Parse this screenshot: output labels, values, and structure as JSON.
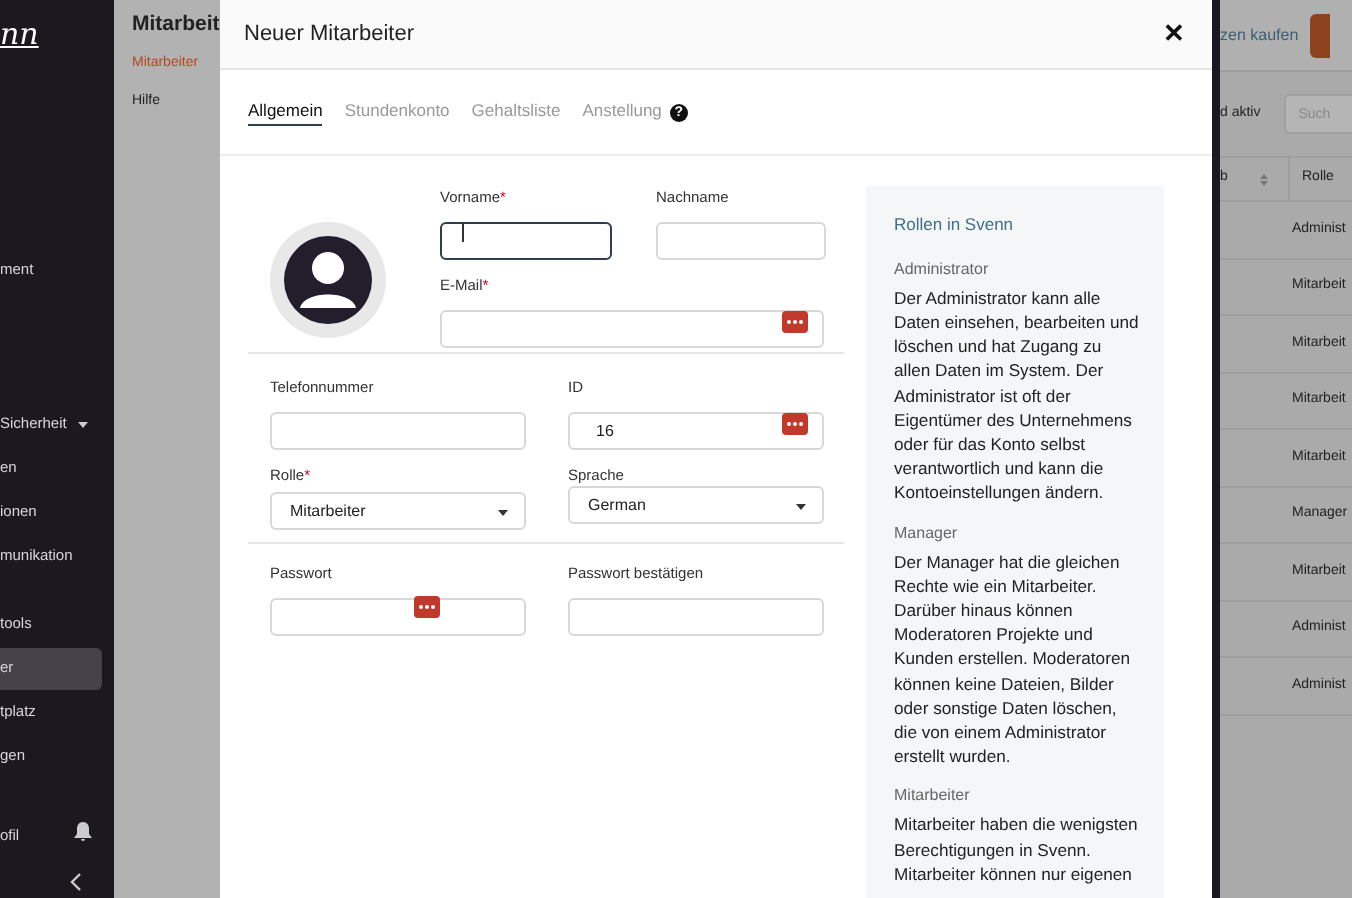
{
  "sidebar": {
    "logo": "nn",
    "items": [
      {
        "label": "ment",
        "selected": false,
        "caret": false
      },
      {
        "label": "Sicherheit",
        "selected": false,
        "caret": true
      },
      {
        "label": "en",
        "selected": false,
        "caret": false
      },
      {
        "label": "ionen",
        "selected": false,
        "caret": false
      },
      {
        "label": "munikation",
        "selected": false,
        "caret": false
      },
      {
        "label": "tools",
        "selected": false,
        "caret": false
      },
      {
        "label": "er",
        "selected": true,
        "caret": false
      },
      {
        "label": "tplatz",
        "selected": false,
        "caret": false
      },
      {
        "label": "gen",
        "selected": false,
        "caret": false
      }
    ],
    "profile": "ofil"
  },
  "subnav": {
    "title": "Mitarbeit",
    "items": [
      {
        "label": "Mitarbeiter",
        "selected": true
      },
      {
        "label": "Hilfe",
        "selected": false
      }
    ]
  },
  "background": {
    "buy_button": "zen kaufen",
    "filter": "d aktiv",
    "search": {
      "placeholder": "Such"
    },
    "columns": [
      "b",
      "Rolle"
    ],
    "rows": [
      "Administ",
      "Mitarbeit",
      "Mitarbeit",
      "Mitarbeit",
      "Mitarbeit",
      "Manager",
      "Mitarbeit",
      "Administ",
      "Administ"
    ]
  },
  "dialog": {
    "title": "Neuer Mitarbeiter",
    "close": "✕",
    "tabs": [
      {
        "label": "Allgemein",
        "selected": true
      },
      {
        "label": "Stundenkonto",
        "selected": false
      },
      {
        "label": "Gehaltsliste",
        "selected": false
      },
      {
        "label": "Anstellung",
        "selected": false,
        "help": "?"
      }
    ],
    "fields": {
      "first_name": {
        "label": "Vorname",
        "required_mark": "*"
      },
      "last_name": {
        "label": "Nachname"
      },
      "email": {
        "label": "E-Mail",
        "required_mark": "*"
      },
      "phone": {
        "label": "Telefonnummer"
      },
      "id": {
        "label": "ID",
        "value": "16"
      },
      "role": {
        "label": "Rolle",
        "required_mark": "*",
        "value": "Mitarbeiter"
      },
      "language": {
        "label": "Sprache",
        "value": "German"
      },
      "password": {
        "label": "Passwort"
      },
      "password_confirm": {
        "label": "Passwort bestätigen"
      }
    },
    "info": {
      "title": "Rollen in Svenn",
      "roles": [
        {
          "name": "Administrator",
          "text": "Der Administrator kann alle Daten einsehen, bearbeiten und löschen und hat Zugang zu allen Daten im System. Der Administrator ist oft der Eigentümer des Unternehmens oder für das Konto selbst verantwortlich und kann die Kontoeinstellungen ändern."
        },
        {
          "name": "Manager",
          "text": "Der Manager hat die gleichen Rechte wie ein Mitarbeiter. Darüber hinaus können Moderatoren Projekte und Kunden erstellen. Moderatoren können keine Dateien, Bilder oder sonstige Daten löschen, die von einem Administrator erstellt wurden."
        },
        {
          "name": "Mitarbeiter",
          "text": "Mitarbeiter haben die wenigsten Berechtigungen in Svenn. Mitarbeiter können nur eigenen"
        }
      ]
    }
  }
}
